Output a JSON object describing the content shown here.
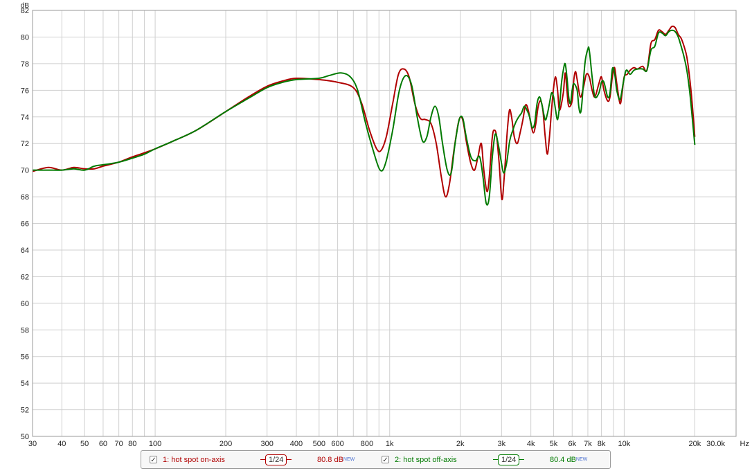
{
  "chart_data": {
    "type": "line",
    "x_scale": "log",
    "xlim": [
      30,
      30000
    ],
    "ylim": [
      50,
      82
    ],
    "ylabel": "dB",
    "x_unit": "Hz",
    "grid": true,
    "legend_placement": "bottom-center",
    "y_ticks": [
      50,
      52,
      54,
      56,
      58,
      60,
      62,
      64,
      66,
      68,
      70,
      72,
      74,
      76,
      78,
      80,
      82
    ],
    "x_ticks": [
      {
        "v": 30,
        "label": "30"
      },
      {
        "v": 40,
        "label": "40"
      },
      {
        "v": 50,
        "label": "50"
      },
      {
        "v": 60,
        "label": "60"
      },
      {
        "v": 70,
        "label": "70"
      },
      {
        "v": 80,
        "label": "80"
      },
      {
        "v": 100,
        "label": "100"
      },
      {
        "v": 200,
        "label": "200"
      },
      {
        "v": 300,
        "label": "300"
      },
      {
        "v": 400,
        "label": "400"
      },
      {
        "v": 500,
        "label": "500"
      },
      {
        "v": 600,
        "label": "600"
      },
      {
        "v": 800,
        "label": "800"
      },
      {
        "v": 1000,
        "label": "1k"
      },
      {
        "v": 2000,
        "label": "2k"
      },
      {
        "v": 3000,
        "label": "3k"
      },
      {
        "v": 4000,
        "label": "4k"
      },
      {
        "v": 5000,
        "label": "5k"
      },
      {
        "v": 6000,
        "label": "6k"
      },
      {
        "v": 7000,
        "label": "7k"
      },
      {
        "v": 8000,
        "label": "8k"
      },
      {
        "v": 10000,
        "label": "10k"
      },
      {
        "v": 20000,
        "label": "20k"
      },
      {
        "v": 30000,
        "label": "30.0k"
      }
    ],
    "series": [
      {
        "name": "1: hot spot on-axis",
        "color": "#b00000",
        "points": [
          [
            30,
            69.9
          ],
          [
            35,
            70.2
          ],
          [
            40,
            70.0
          ],
          [
            45,
            70.2
          ],
          [
            50,
            70.1
          ],
          [
            55,
            70.1
          ],
          [
            60,
            70.3
          ],
          [
            70,
            70.6
          ],
          [
            80,
            71.0
          ],
          [
            90,
            71.3
          ],
          [
            100,
            71.6
          ],
          [
            120,
            72.2
          ],
          [
            150,
            73.0
          ],
          [
            200,
            74.4
          ],
          [
            250,
            75.5
          ],
          [
            300,
            76.3
          ],
          [
            350,
            76.7
          ],
          [
            400,
            76.9
          ],
          [
            500,
            76.8
          ],
          [
            600,
            76.6
          ],
          [
            700,
            76.2
          ],
          [
            760,
            75.0
          ],
          [
            820,
            73.0
          ],
          [
            880,
            71.6
          ],
          [
            920,
            71.5
          ],
          [
            970,
            72.6
          ],
          [
            1030,
            75.0
          ],
          [
            1090,
            77.2
          ],
          [
            1150,
            77.6
          ],
          [
            1210,
            77.0
          ],
          [
            1280,
            75.0
          ],
          [
            1350,
            73.9
          ],
          [
            1420,
            73.8
          ],
          [
            1500,
            73.5
          ],
          [
            1580,
            72.0
          ],
          [
            1660,
            69.5
          ],
          [
            1730,
            68.0
          ],
          [
            1800,
            69.0
          ],
          [
            1880,
            71.5
          ],
          [
            1960,
            73.5
          ],
          [
            2010,
            74.0
          ],
          [
            2060,
            73.6
          ],
          [
            2130,
            72.0
          ],
          [
            2220,
            70.5
          ],
          [
            2300,
            70.0
          ],
          [
            2380,
            71.0
          ],
          [
            2460,
            72.0
          ],
          [
            2520,
            70.0
          ],
          [
            2600,
            68.4
          ],
          [
            2660,
            69.5
          ],
          [
            2740,
            72.5
          ],
          [
            2800,
            73.0
          ],
          [
            2860,
            72.5
          ],
          [
            2930,
            70.5
          ],
          [
            3010,
            67.8
          ],
          [
            3080,
            69.5
          ],
          [
            3170,
            72.8
          ],
          [
            3240,
            74.5
          ],
          [
            3310,
            74.0
          ],
          [
            3400,
            72.5
          ],
          [
            3500,
            72.0
          ],
          [
            3600,
            72.8
          ],
          [
            3700,
            73.8
          ],
          [
            3800,
            74.9
          ],
          [
            3900,
            74.5
          ],
          [
            4000,
            73.5
          ],
          [
            4100,
            72.8
          ],
          [
            4200,
            73.5
          ],
          [
            4300,
            74.8
          ],
          [
            4400,
            75.2
          ],
          [
            4500,
            74.5
          ],
          [
            4600,
            72.6
          ],
          [
            4700,
            71.2
          ],
          [
            4800,
            72.5
          ],
          [
            4900,
            74.5
          ],
          [
            5000,
            76.2
          ],
          [
            5100,
            77.0
          ],
          [
            5200,
            76.0
          ],
          [
            5300,
            74.5
          ],
          [
            5500,
            75.8
          ],
          [
            5600,
            77.3
          ],
          [
            5700,
            76.0
          ],
          [
            5800,
            74.8
          ],
          [
            6000,
            75.2
          ],
          [
            6100,
            76.8
          ],
          [
            6200,
            77.4
          ],
          [
            6300,
            76.8
          ],
          [
            6500,
            75.5
          ],
          [
            6700,
            76.2
          ],
          [
            6900,
            77.2
          ],
          [
            7100,
            77.0
          ],
          [
            7300,
            76.0
          ],
          [
            7500,
            75.5
          ],
          [
            7800,
            76.5
          ],
          [
            8000,
            77.0
          ],
          [
            8200,
            76.0
          ],
          [
            8500,
            75.2
          ],
          [
            8700,
            75.5
          ],
          [
            8900,
            77.0
          ],
          [
            9100,
            77.7
          ],
          [
            9300,
            76.5
          ],
          [
            9600,
            75.0
          ],
          [
            9800,
            75.8
          ],
          [
            10000,
            77.0
          ],
          [
            10300,
            77.2
          ],
          [
            10600,
            77.5
          ],
          [
            11000,
            77.7
          ],
          [
            11400,
            77.6
          ],
          [
            12000,
            77.8
          ],
          [
            12500,
            77.5
          ],
          [
            13000,
            79.5
          ],
          [
            13500,
            79.8
          ],
          [
            14000,
            80.5
          ],
          [
            14500,
            80.4
          ],
          [
            15000,
            80.2
          ],
          [
            15500,
            80.5
          ],
          [
            16000,
            80.8
          ],
          [
            16500,
            80.7
          ],
          [
            17000,
            80.2
          ],
          [
            17500,
            79.9
          ],
          [
            18000,
            79.3
          ],
          [
            18500,
            78.5
          ],
          [
            19000,
            77.0
          ],
          [
            19500,
            75.0
          ],
          [
            20000,
            72.5
          ]
        ]
      },
      {
        "name": "2: hot spot off-axis",
        "color": "#007a00",
        "points": [
          [
            30,
            70.0
          ],
          [
            35,
            70.0
          ],
          [
            40,
            70.0
          ],
          [
            45,
            70.1
          ],
          [
            50,
            70.0
          ],
          [
            55,
            70.3
          ],
          [
            60,
            70.4
          ],
          [
            70,
            70.6
          ],
          [
            80,
            70.9
          ],
          [
            90,
            71.2
          ],
          [
            100,
            71.6
          ],
          [
            120,
            72.2
          ],
          [
            150,
            73.0
          ],
          [
            200,
            74.4
          ],
          [
            250,
            75.4
          ],
          [
            300,
            76.2
          ],
          [
            350,
            76.6
          ],
          [
            400,
            76.8
          ],
          [
            500,
            76.9
          ],
          [
            550,
            77.1
          ],
          [
            620,
            77.3
          ],
          [
            680,
            77.0
          ],
          [
            730,
            76.0
          ],
          [
            790,
            73.5
          ],
          [
            850,
            71.5
          ],
          [
            910,
            70.0
          ],
          [
            960,
            70.5
          ],
          [
            1030,
            73.0
          ],
          [
            1100,
            76.0
          ],
          [
            1170,
            77.1
          ],
          [
            1240,
            76.4
          ],
          [
            1310,
            74.0
          ],
          [
            1380,
            72.2
          ],
          [
            1440,
            72.5
          ],
          [
            1500,
            74.0
          ],
          [
            1560,
            74.8
          ],
          [
            1620,
            74.0
          ],
          [
            1680,
            72.0
          ],
          [
            1760,
            70.0
          ],
          [
            1830,
            69.8
          ],
          [
            1900,
            72.0
          ],
          [
            1980,
            73.8
          ],
          [
            2050,
            73.9
          ],
          [
            2120,
            72.5
          ],
          [
            2220,
            71.0
          ],
          [
            2320,
            70.7
          ],
          [
            2420,
            71.0
          ],
          [
            2500,
            69.5
          ],
          [
            2580,
            67.5
          ],
          [
            2660,
            68.0
          ],
          [
            2740,
            71.0
          ],
          [
            2820,
            72.7
          ],
          [
            2900,
            72.0
          ],
          [
            2980,
            70.8
          ],
          [
            3060,
            69.8
          ],
          [
            3150,
            70.5
          ],
          [
            3250,
            72.2
          ],
          [
            3350,
            73.0
          ],
          [
            3450,
            73.6
          ],
          [
            3550,
            74.0
          ],
          [
            3650,
            74.3
          ],
          [
            3750,
            74.8
          ],
          [
            3850,
            74.5
          ],
          [
            3950,
            74.0
          ],
          [
            4050,
            73.2
          ],
          [
            4150,
            73.5
          ],
          [
            4250,
            75.0
          ],
          [
            4350,
            75.5
          ],
          [
            4450,
            75.0
          ],
          [
            4600,
            73.8
          ],
          [
            4700,
            74.2
          ],
          [
            4800,
            75.0
          ],
          [
            4900,
            75.8
          ],
          [
            5000,
            75.5
          ],
          [
            5100,
            74.5
          ],
          [
            5200,
            73.8
          ],
          [
            5300,
            74.8
          ],
          [
            5400,
            76.5
          ],
          [
            5500,
            77.5
          ],
          [
            5600,
            78.0
          ],
          [
            5700,
            77.0
          ],
          [
            5800,
            75.5
          ],
          [
            5900,
            75.0
          ],
          [
            6000,
            76.0
          ],
          [
            6100,
            76.5
          ],
          [
            6300,
            76.0
          ],
          [
            6400,
            74.8
          ],
          [
            6500,
            74.3
          ],
          [
            6600,
            75.0
          ],
          [
            6800,
            78.0
          ],
          [
            7000,
            79.1
          ],
          [
            7100,
            79.0
          ],
          [
            7300,
            77.0
          ],
          [
            7500,
            75.5
          ],
          [
            7800,
            75.8
          ],
          [
            8000,
            76.6
          ],
          [
            8200,
            76.6
          ],
          [
            8500,
            75.5
          ],
          [
            8700,
            75.8
          ],
          [
            8900,
            77.6
          ],
          [
            9100,
            77.3
          ],
          [
            9300,
            76.0
          ],
          [
            9600,
            75.3
          ],
          [
            9900,
            76.5
          ],
          [
            10200,
            77.5
          ],
          [
            10600,
            77.2
          ],
          [
            11000,
            77.5
          ],
          [
            11400,
            77.6
          ],
          [
            12000,
            77.6
          ],
          [
            12500,
            77.5
          ],
          [
            13000,
            79.0
          ],
          [
            13500,
            79.3
          ],
          [
            14000,
            80.3
          ],
          [
            14500,
            80.3
          ],
          [
            15000,
            80.1
          ],
          [
            15500,
            80.4
          ],
          [
            16000,
            80.5
          ],
          [
            16500,
            80.4
          ],
          [
            17000,
            80.0
          ],
          [
            17500,
            79.3
          ],
          [
            18000,
            78.5
          ],
          [
            18500,
            77.5
          ],
          [
            19000,
            76.0
          ],
          [
            19500,
            74.0
          ],
          [
            20000,
            71.9
          ]
        ]
      }
    ]
  },
  "legend": {
    "items": [
      {
        "checked_glyph": "✓",
        "label": "1: hot spot on-axis",
        "smoothing": "1/24",
        "value": "80.8 dB",
        "badge": "NEW",
        "color": "#b00000"
      },
      {
        "checked_glyph": "✓",
        "label": "2: hot spot off-axis",
        "smoothing": "1/24",
        "value": "80.4 dB",
        "badge": "NEW",
        "color": "#007a00"
      }
    ]
  }
}
